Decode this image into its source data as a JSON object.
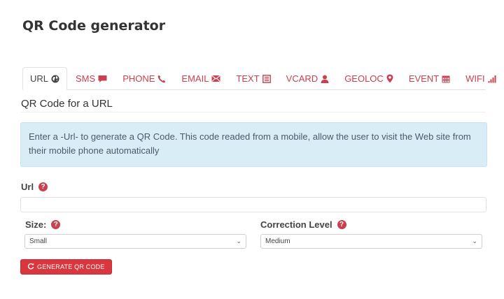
{
  "page": {
    "title": "QR Code generator"
  },
  "tabs": [
    {
      "label": "URL",
      "icon": "globe-icon",
      "active": true
    },
    {
      "label": "SMS",
      "icon": "comment-icon",
      "active": false
    },
    {
      "label": "PHONE",
      "icon": "phone-icon",
      "active": false
    },
    {
      "label": "EMAIL",
      "icon": "envelope-icon",
      "active": false
    },
    {
      "label": "TEXT",
      "icon": "document-icon",
      "active": false
    },
    {
      "label": "VCARD",
      "icon": "user-icon",
      "active": false
    },
    {
      "label": "GEOLOC",
      "icon": "map-marker-icon",
      "active": false
    },
    {
      "label": "EVENT",
      "icon": "calendar-icon",
      "active": false
    },
    {
      "label": "WIFI",
      "icon": "signal-icon",
      "active": false
    }
  ],
  "section": {
    "title": "QR Code for a URL",
    "info": "Enter a -Url- to generate a QR Code. This code readed from a mobile, allow the user to visit the Web site from their mobile phone automatically"
  },
  "form": {
    "url_label": "Url",
    "url_value": "",
    "size_label": "Size:",
    "size_value": "Small",
    "correction_label": "Correction Level",
    "correction_value": "Medium",
    "generate_label": "GENERATE QR CODE"
  },
  "colors": {
    "accent": "#c9404f",
    "button": "#d9363e",
    "info_bg": "#d9edf7"
  }
}
